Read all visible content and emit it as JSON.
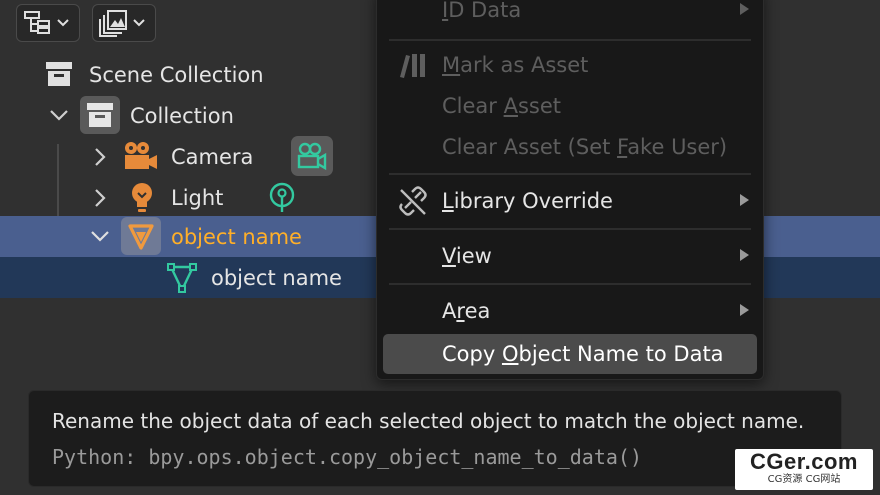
{
  "outliner": {
    "rows": [
      {
        "label": "Scene Collection"
      },
      {
        "label": "Collection"
      },
      {
        "label": "Camera"
      },
      {
        "label": "Light"
      },
      {
        "label": "object name"
      },
      {
        "label": "object name"
      }
    ]
  },
  "menu": {
    "items": [
      {
        "label": "ID Data",
        "mnemonic": "I",
        "rest": "D Data",
        "enabled": false
      },
      {
        "label": "Mark as Asset",
        "mnemonic": "M",
        "rest": "ark as Asset",
        "enabled": false
      },
      {
        "label": "Clear Asset",
        "pre": "Clear ",
        "mnemonic": "A",
        "rest": "sset",
        "enabled": false
      },
      {
        "label": "Clear Asset (Set Fake User)",
        "pre": "Clear Asset (Set ",
        "mnemonic": "F",
        "rest": "ake User)",
        "enabled": false
      },
      {
        "label": "Library Override",
        "mnemonic": "L",
        "rest": "ibrary Override",
        "enabled": true
      },
      {
        "label": "View",
        "mnemonic": "V",
        "rest": "iew",
        "enabled": true
      },
      {
        "label": "Area",
        "pre": "A",
        "mnemonic": "r",
        "rest": "ea",
        "enabled": true
      },
      {
        "label": "Copy Object Name to Data",
        "pre": "Copy ",
        "mnemonic": "O",
        "rest": "bject Name to Data",
        "enabled": true
      }
    ]
  },
  "tooltip": {
    "description": "Rename the object data of each selected object to match the object name.",
    "python": "Python: bpy.ops.object.copy_object_name_to_data()"
  },
  "watermark": {
    "title": "CGer.com",
    "subtitle": "CG资源 CG网站"
  },
  "colors": {
    "background": "#303030",
    "selected_row": "#4a5f8f",
    "child_row": "#223858",
    "active_name": "#ffaf29",
    "object_icon": "#e68a3a",
    "data_icon": "#33c9a0",
    "menu_bg": "#181818",
    "menu_highlight": "#4b4b4b",
    "disabled_text": "#5e5e5e"
  },
  "icons": {
    "display_mode": "outliner-tree-icon",
    "filter": "image-stack-icon",
    "collection": "collection-box-icon",
    "camera": "camera-icon",
    "camera_data": "camera-data-icon",
    "light": "light-bulb-icon",
    "light_data": "light-data-icon",
    "mesh_object": "mesh-object-icon",
    "mesh_data": "mesh-data-icon"
  }
}
